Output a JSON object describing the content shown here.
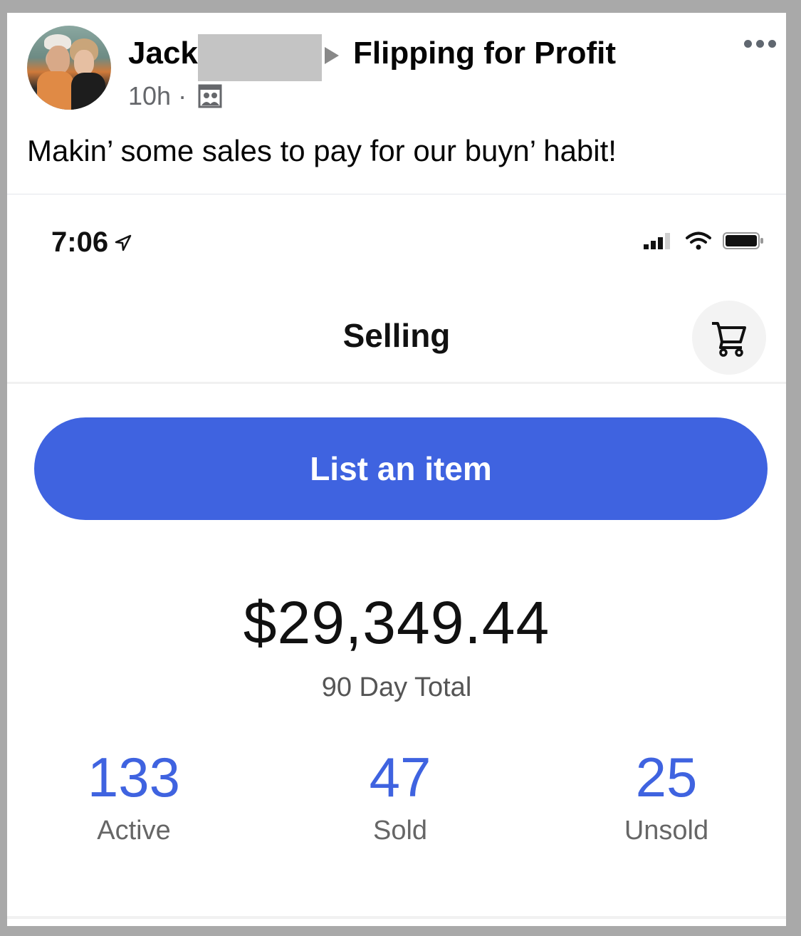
{
  "post": {
    "author_name": "Jack",
    "group_name": "Flipping for Profit",
    "timestamp": "10h",
    "separator": "·",
    "audience_icon": "group-audience-icon",
    "more_icon": "more-options-icon",
    "text": "Makin’ some sales to pay for our buyn’ habit!"
  },
  "phone": {
    "status_time": "7:06",
    "status_icons": [
      "signal-icon",
      "wifi-icon",
      "battery-icon"
    ],
    "nav_title": "Selling",
    "cart_icon": "shopping-cart-icon",
    "list_button_label": "List an item",
    "total_amount": "$29,349.44",
    "total_label": "90 Day Total",
    "stats": [
      {
        "value": "133",
        "label": "Active"
      },
      {
        "value": "47",
        "label": "Sold"
      },
      {
        "value": "25",
        "label": "Unsold"
      }
    ],
    "accent_color": "#3f63e0"
  }
}
